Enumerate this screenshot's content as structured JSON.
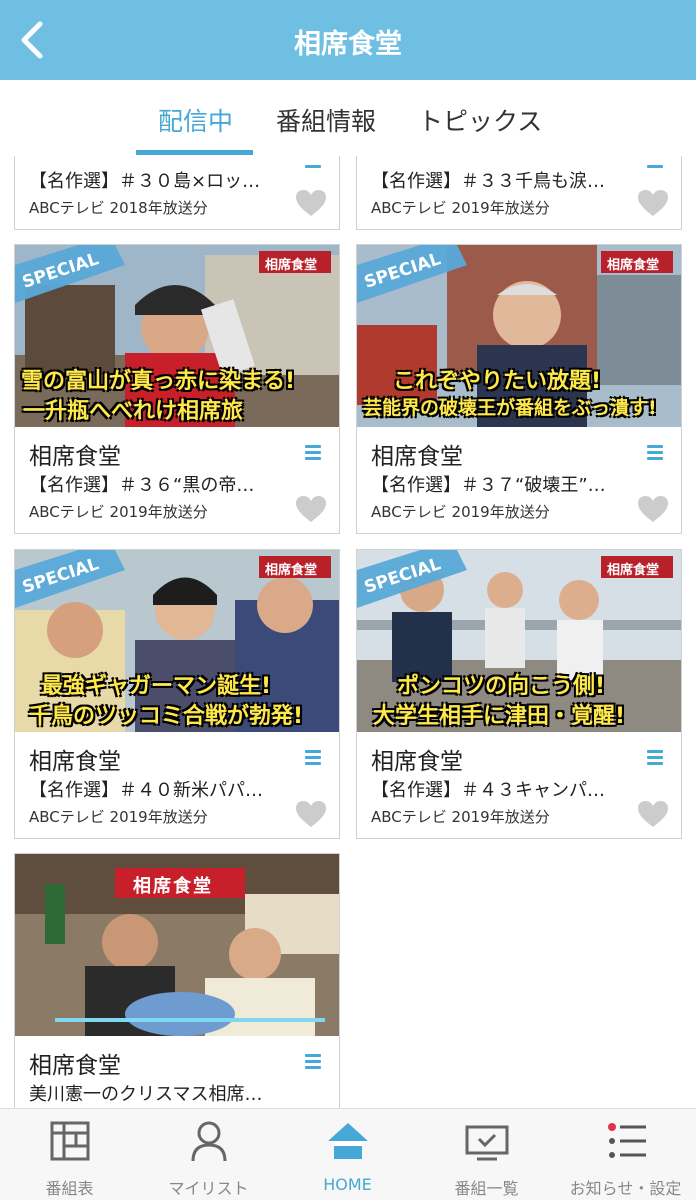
{
  "header": {
    "title": "相席食堂"
  },
  "tabs": [
    {
      "label": "配信中",
      "active": true
    },
    {
      "label": "番組情報",
      "active": false
    },
    {
      "label": "トピックス",
      "active": false
    }
  ],
  "cards": [
    {
      "title": "",
      "desc": "【名作選】＃３０島×ロッ…",
      "meta": "ABCテレビ  2018年放送分"
    },
    {
      "title": "",
      "desc": "【名作選】＃３３千鳥も涙…",
      "meta": "ABCテレビ  2019年放送分"
    },
    {
      "title": "相席食堂",
      "desc": "【名作選】＃３６“黒の帝…",
      "meta": "ABCテレビ  2019年放送分",
      "thumb": {
        "special": "SPECIAL",
        "badge": "相席食堂",
        "line1": "雪の富山が真っ赤に染まる!",
        "line2": "一升瓶へべれけ相席旅"
      }
    },
    {
      "title": "相席食堂",
      "desc": "【名作選】＃３７“破壊王”…",
      "meta": "ABCテレビ  2019年放送分",
      "thumb": {
        "special": "SPECIAL",
        "badge": "相席食堂",
        "line1": "これぞやりたい放題!",
        "line2": "芸能界の破壊王が番組をぶっ潰す!"
      }
    },
    {
      "title": "相席食堂",
      "desc": "【名作選】＃４０新米パパ…",
      "meta": "ABCテレビ  2019年放送分",
      "thumb": {
        "special": "SPECIAL",
        "badge": "相席食堂",
        "line1": "最強ギャガーマン誕生!",
        "line2": "千鳥のツッコミ合戦が勃発!"
      }
    },
    {
      "title": "相席食堂",
      "desc": "【名作選】＃４３キャンパ…",
      "meta": "ABCテレビ  2019年放送分",
      "thumb": {
        "special": "SPECIAL",
        "badge": "相席食堂",
        "line1": "ポンコツの向こう側!",
        "line2": "大学生相手に津田・覚醒!"
      }
    },
    {
      "title": "相席食堂",
      "desc": "美川憲一のクリスマス相席…",
      "meta": "",
      "thumb": {
        "sign": "相席食堂"
      }
    }
  ],
  "nav": [
    {
      "label": "番組表",
      "icon": "program-guide-icon",
      "active": false
    },
    {
      "label": "マイリスト",
      "icon": "person-icon",
      "active": false
    },
    {
      "label": "HOME",
      "icon": "home-icon",
      "active": true
    },
    {
      "label": "番組一覧",
      "icon": "tv-list-icon",
      "active": false
    },
    {
      "label": "お知らせ・設定",
      "icon": "notice-settings-icon",
      "active": false
    }
  ],
  "colors": {
    "accent": "#46a8d6",
    "header": "#6fbfe3",
    "heart": "#cccccc"
  }
}
